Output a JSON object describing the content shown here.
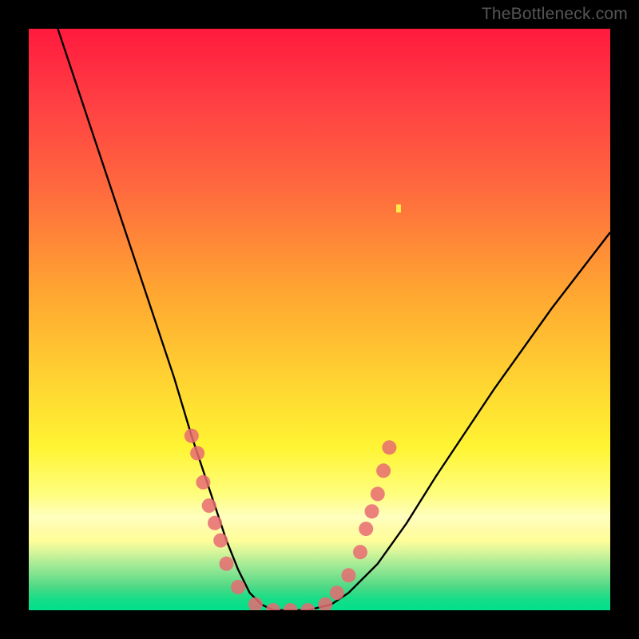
{
  "watermark": "TheBottleneck.com",
  "chart_data": {
    "type": "line",
    "title": "",
    "xlabel": "",
    "ylabel": "",
    "xlim": [
      0,
      100
    ],
    "ylim": [
      0,
      100
    ],
    "series": [
      {
        "name": "bottleneck-curve",
        "x": [
          5,
          10,
          15,
          20,
          25,
          28,
          30,
          32,
          34,
          36,
          38,
          40,
          42,
          45,
          48,
          52,
          55,
          60,
          65,
          70,
          80,
          90,
          100
        ],
        "y": [
          100,
          85,
          70,
          55,
          40,
          30,
          24,
          18,
          12,
          7,
          3,
          1,
          0,
          0,
          0,
          1,
          3,
          8,
          15,
          23,
          38,
          52,
          65
        ]
      }
    ],
    "markers": {
      "name": "highlight-dots",
      "color": "#e86b72",
      "points": [
        {
          "x": 28,
          "y": 30
        },
        {
          "x": 29,
          "y": 27
        },
        {
          "x": 30,
          "y": 22
        },
        {
          "x": 31,
          "y": 18
        },
        {
          "x": 32,
          "y": 15
        },
        {
          "x": 33,
          "y": 12
        },
        {
          "x": 34,
          "y": 8
        },
        {
          "x": 36,
          "y": 4
        },
        {
          "x": 39,
          "y": 1
        },
        {
          "x": 42,
          "y": 0
        },
        {
          "x": 45,
          "y": 0
        },
        {
          "x": 48,
          "y": 0
        },
        {
          "x": 51,
          "y": 1
        },
        {
          "x": 53,
          "y": 3
        },
        {
          "x": 55,
          "y": 6
        },
        {
          "x": 57,
          "y": 10
        },
        {
          "x": 58,
          "y": 14
        },
        {
          "x": 59,
          "y": 17
        },
        {
          "x": 60,
          "y": 20
        },
        {
          "x": 61,
          "y": 24
        },
        {
          "x": 62,
          "y": 28
        }
      ]
    },
    "gradient_stops": [
      {
        "pos": 0,
        "color": "#ff1a3e"
      },
      {
        "pos": 45,
        "color": "#ffa531"
      },
      {
        "pos": 72,
        "color": "#fff433"
      },
      {
        "pos": 100,
        "color": "#00e08c"
      }
    ]
  }
}
